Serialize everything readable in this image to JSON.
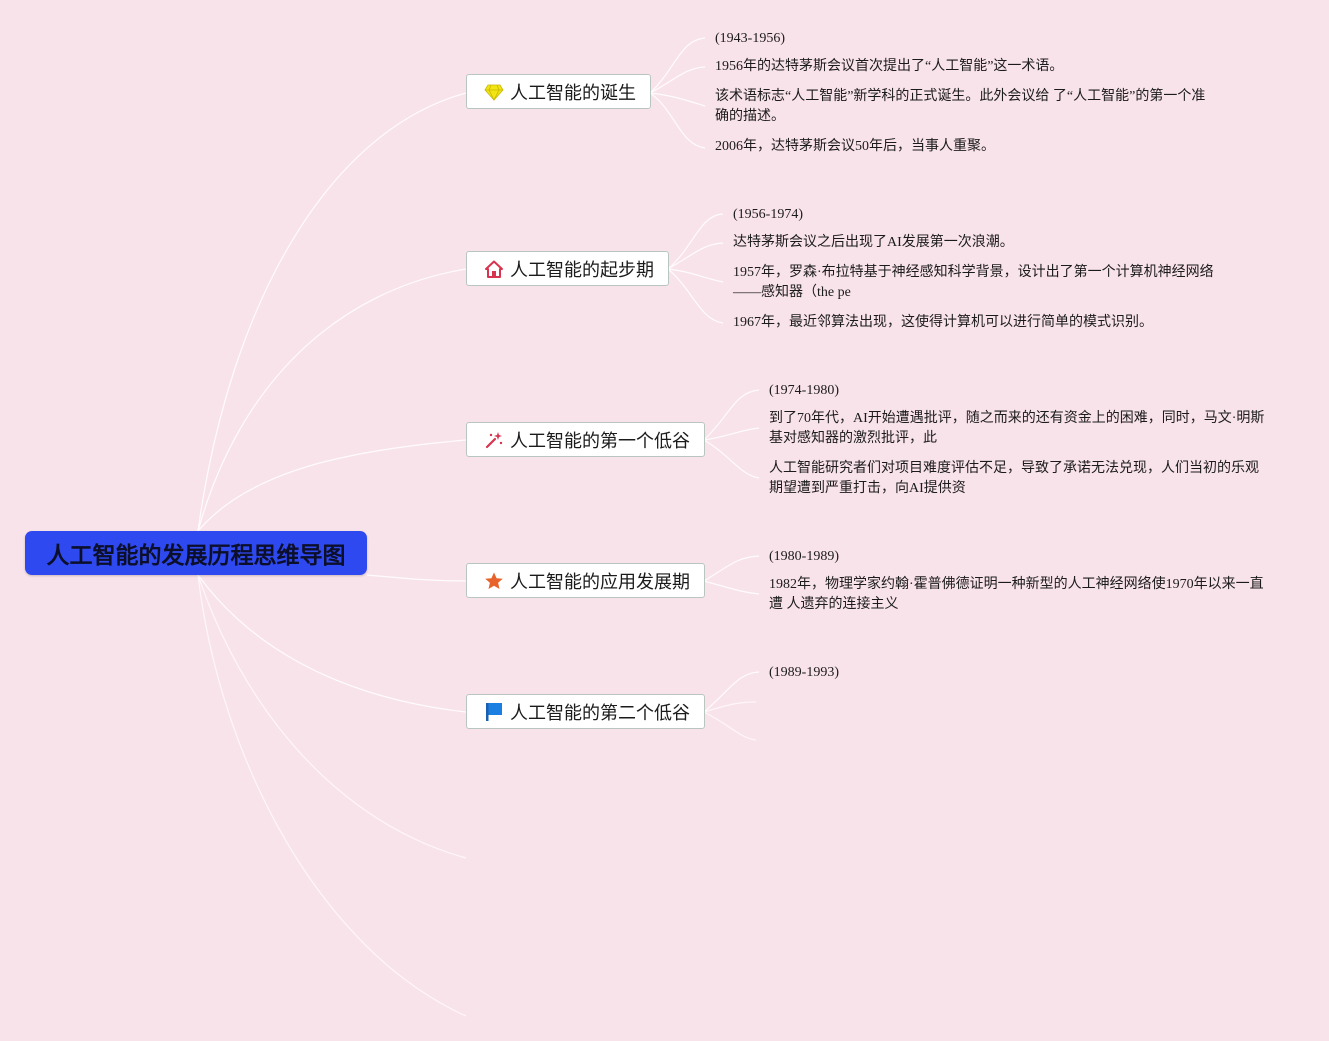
{
  "root": {
    "title": "人工智能的发展历程思维导图"
  },
  "branches": [
    {
      "title": "人工智能的诞生",
      "icon": "diamond-icon",
      "notes": [
        "(1943-1956)",
        "1956年的达特茅斯会议首次提出了“人工智能”这一术语。",
        "该术语标志“人工智能”新学科的正式诞生。此外会议给 了“人工智能”的第一个准确的描述。",
        "2006年，达特茅斯会议50年后，当事人重聚。"
      ]
    },
    {
      "title": "人工智能的起步期",
      "icon": "house-icon",
      "notes": [
        "(1956-1974)",
        "达特茅斯会议之后出现了AI发展第一次浪潮。",
        "1957年，罗森·布拉特基于神经感知科学背景，设计出了第一个计算机神经网络——感知器（the pe",
        "1967年，最近邻算法出现，这使得计算机可以进行简单的模式识别。"
      ]
    },
    {
      "title": "人工智能的第一个低谷",
      "icon": "magic-wand-icon",
      "notes": [
        "(1974-1980)",
        "到了70年代，AI开始遭遇批评，随之而来的还有资金上的困难，同时，马文·明斯基对感知器的激烈批评，此",
        "人工智能研究者们对项目难度评估不足，导致了承诺无法兑现，人们当初的乐观期望遭到严重打击，向AI提供资"
      ]
    },
    {
      "title": "人工智能的应用发展期",
      "icon": "star-icon",
      "notes": [
        "(1980-1989)",
        "1982年，物理学家约翰·霍普佛德证明一种新型的人工神经网络使1970年以来一直遭 人遗弃的连接主义"
      ]
    },
    {
      "title": "人工智能的第二个低谷",
      "icon": "flag-icon",
      "notes": [
        "(1989-1993)"
      ]
    }
  ],
  "colors": {
    "background": "#f9e3ea",
    "root_fill": "#2f49f0",
    "connector": "#ffffff",
    "topic_border": "#b9c6c0",
    "diamond": "#f2e415",
    "house": "#d8334f",
    "wand": "#d8334f",
    "star": "#e8632b",
    "flag": "#1a7fe0"
  }
}
